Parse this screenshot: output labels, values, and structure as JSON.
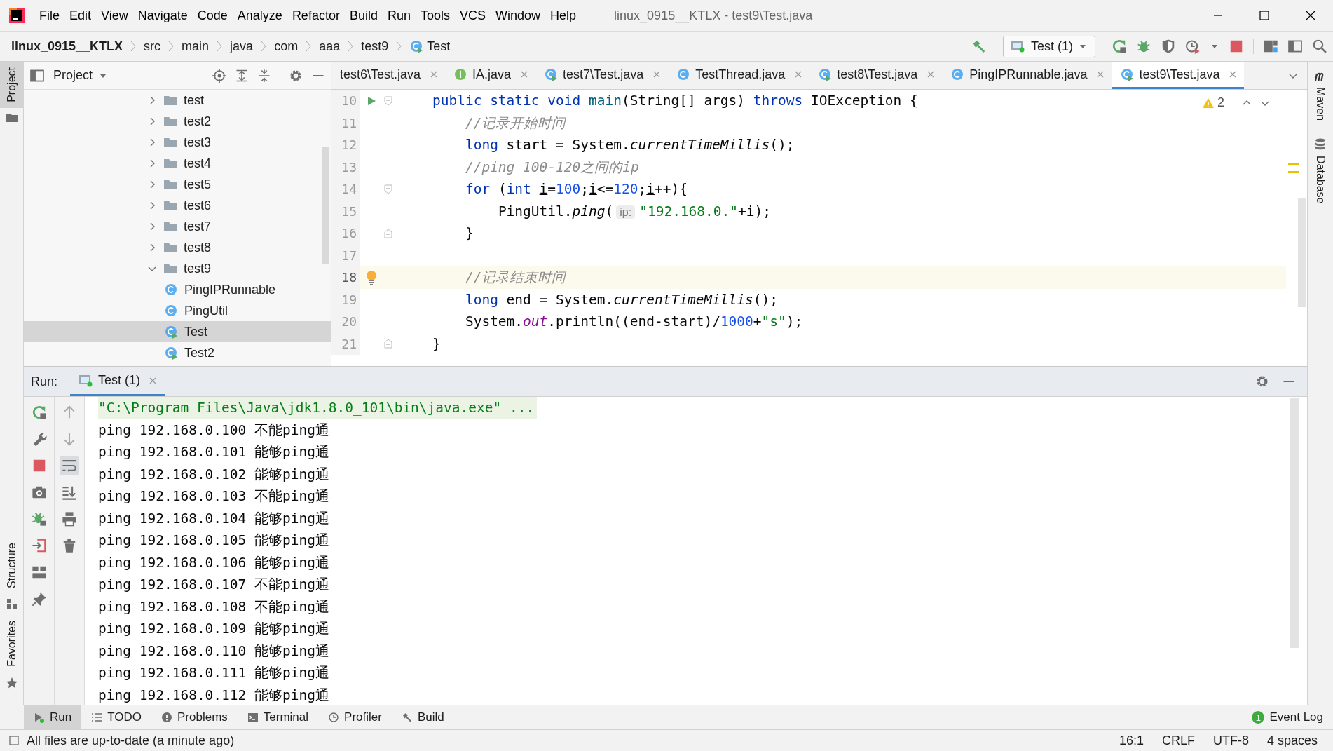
{
  "window": {
    "title": "linux_0915__KTLX - test9\\Test.java"
  },
  "menu": [
    {
      "label": "File"
    },
    {
      "label": "Edit"
    },
    {
      "label": "View"
    },
    {
      "label": "Navigate"
    },
    {
      "label": "Code"
    },
    {
      "label": "Analyze"
    },
    {
      "label": "Refactor"
    },
    {
      "label": "Build"
    },
    {
      "label": "Run"
    },
    {
      "label": "Tools"
    },
    {
      "label": "VCS"
    },
    {
      "label": "Window"
    },
    {
      "label": "Help"
    }
  ],
  "breadcrumbs": [
    {
      "label": "linux_0915__KTLX",
      "kind": "project"
    },
    {
      "label": "src",
      "kind": "folder"
    },
    {
      "label": "main",
      "kind": "folder"
    },
    {
      "label": "java",
      "kind": "folder"
    },
    {
      "label": "com",
      "kind": "folder"
    },
    {
      "label": "aaa",
      "kind": "folder"
    },
    {
      "label": "test9",
      "kind": "folder"
    },
    {
      "label": "Test",
      "kind": "runnable-class"
    }
  ],
  "run_configuration": {
    "label": "Test (1)"
  },
  "left_strip": [
    {
      "label": "Project",
      "selected": true
    },
    {
      "label": "Structure",
      "selected": false
    },
    {
      "label": "Favorites",
      "selected": false
    }
  ],
  "right_strip": [
    {
      "label": "Maven"
    },
    {
      "label": "Database"
    }
  ],
  "project_panel": {
    "title": "Project",
    "tree": [
      {
        "label": "test",
        "kind": "folder",
        "expanded": false,
        "selected": false
      },
      {
        "label": "test2",
        "kind": "folder",
        "expanded": false,
        "selected": false
      },
      {
        "label": "test3",
        "kind": "folder",
        "expanded": false,
        "selected": false
      },
      {
        "label": "test4",
        "kind": "folder",
        "expanded": false,
        "selected": false
      },
      {
        "label": "test5",
        "kind": "folder",
        "expanded": false,
        "selected": false
      },
      {
        "label": "test6",
        "kind": "folder",
        "expanded": false,
        "selected": false
      },
      {
        "label": "test7",
        "kind": "folder",
        "expanded": false,
        "selected": false
      },
      {
        "label": "test8",
        "kind": "folder",
        "expanded": false,
        "selected": false
      },
      {
        "label": "test9",
        "kind": "folder",
        "expanded": true,
        "selected": false,
        "children": [
          {
            "label": "PingIPRunnable",
            "kind": "class",
            "selected": false
          },
          {
            "label": "PingUtil",
            "kind": "class",
            "selected": false
          },
          {
            "label": "Test",
            "kind": "runnable-class",
            "selected": true
          },
          {
            "label": "Test2",
            "kind": "runnable-class",
            "selected": false
          }
        ]
      }
    ]
  },
  "editor_tabs": [
    {
      "label": "test6\\Test.java",
      "kind": "clipped",
      "selected": false
    },
    {
      "label": "IA.java",
      "kind": "interface",
      "selected": false
    },
    {
      "label": "test7\\Test.java",
      "kind": "runnable-class",
      "selected": false
    },
    {
      "label": "TestThread.java",
      "kind": "class",
      "selected": false
    },
    {
      "label": "test8\\Test.java",
      "kind": "runnable-class",
      "selected": false
    },
    {
      "label": "PingIPRunnable.java",
      "kind": "class",
      "selected": false
    },
    {
      "label": "test9\\Test.java",
      "kind": "runnable-class",
      "selected": true
    }
  ],
  "editor": {
    "warning_count": "2",
    "lines": [
      {
        "number": "10",
        "run_marker": true,
        "fold_start": true,
        "fold_end": false,
        "bulb": false,
        "highlighted": false,
        "tokens": [
          {
            "kind": "kw",
            "text": "    public static void "
          },
          {
            "kind": "decl",
            "text": "main"
          },
          {
            "kind": "plain",
            "text": "(String[] args) "
          },
          {
            "kind": "kw",
            "text": "throws "
          },
          {
            "kind": "plain",
            "text": "IOException {"
          }
        ]
      },
      {
        "number": "11",
        "run_marker": false,
        "fold_start": false,
        "fold_end": false,
        "bulb": false,
        "highlighted": false,
        "tokens": [
          {
            "kind": "comment",
            "text": "        //记录开始时间"
          }
        ]
      },
      {
        "number": "12",
        "run_marker": false,
        "fold_start": false,
        "fold_end": false,
        "bulb": false,
        "highlighted": false,
        "tokens": [
          {
            "kind": "kw",
            "text": "        long "
          },
          {
            "kind": "plain",
            "text": "start = System."
          },
          {
            "kind": "static",
            "text": "currentTimeMillis"
          },
          {
            "kind": "plain",
            "text": "();"
          }
        ]
      },
      {
        "number": "13",
        "run_marker": false,
        "fold_start": false,
        "fold_end": false,
        "bulb": false,
        "highlighted": false,
        "tokens": [
          {
            "kind": "comment",
            "text": "        //ping 100-120之间的ip"
          }
        ]
      },
      {
        "number": "14",
        "run_marker": false,
        "fold_start": true,
        "fold_end": false,
        "bulb": false,
        "highlighted": false,
        "tokens": [
          {
            "kind": "kw",
            "text": "        for "
          },
          {
            "kind": "plain",
            "text": "("
          },
          {
            "kind": "kw",
            "text": "int "
          },
          {
            "kind": "var",
            "text": "i"
          },
          {
            "kind": "plain",
            "text": "="
          },
          {
            "kind": "num",
            "text": "100"
          },
          {
            "kind": "plain",
            "text": ";"
          },
          {
            "kind": "var",
            "text": "i"
          },
          {
            "kind": "plain",
            "text": "<="
          },
          {
            "kind": "num",
            "text": "120"
          },
          {
            "kind": "plain",
            "text": ";"
          },
          {
            "kind": "var",
            "text": "i"
          },
          {
            "kind": "plain",
            "text": "++){"
          }
        ]
      },
      {
        "number": "15",
        "run_marker": false,
        "fold_start": false,
        "fold_end": false,
        "bulb": false,
        "highlighted": false,
        "tokens": [
          {
            "kind": "plain",
            "text": "            PingUtil."
          },
          {
            "kind": "static",
            "text": "ping"
          },
          {
            "kind": "plain",
            "text": "("
          },
          {
            "kind": "hint",
            "text": "ip:"
          },
          {
            "kind": "str",
            "text": "\"192.168.0.\""
          },
          {
            "kind": "plain",
            "text": "+"
          },
          {
            "kind": "var",
            "text": "i"
          },
          {
            "kind": "plain",
            "text": ");"
          }
        ]
      },
      {
        "number": "16",
        "run_marker": false,
        "fold_start": false,
        "fold_end": true,
        "bulb": false,
        "highlighted": false,
        "tokens": [
          {
            "kind": "plain",
            "text": "        }"
          }
        ]
      },
      {
        "number": "17",
        "run_marker": false,
        "fold_start": false,
        "fold_end": false,
        "bulb": false,
        "highlighted": false
      },
      {
        "number": "18",
        "run_marker": false,
        "fold_start": false,
        "fold_end": false,
        "bulb": true,
        "highlighted": true,
        "tokens": [
          {
            "kind": "comment",
            "text": "        //记录结束时间"
          }
        ]
      },
      {
        "number": "19",
        "run_marker": false,
        "fold_start": false,
        "fold_end": false,
        "bulb": false,
        "highlighted": false,
        "tokens": [
          {
            "kind": "kw",
            "text": "        long "
          },
          {
            "kind": "plain",
            "text": "end = System."
          },
          {
            "kind": "static",
            "text": "currentTimeMillis"
          },
          {
            "kind": "plain",
            "text": "();"
          }
        ]
      },
      {
        "number": "20",
        "run_marker": false,
        "fold_start": false,
        "fold_end": false,
        "bulb": false,
        "highlighted": false,
        "tokens": [
          {
            "kind": "plain",
            "text": "        System."
          },
          {
            "kind": "field",
            "text": "out"
          },
          {
            "kind": "plain",
            "text": ".println((end-start)/"
          },
          {
            "kind": "num",
            "text": "1000"
          },
          {
            "kind": "plain",
            "text": "+"
          },
          {
            "kind": "str",
            "text": "\"s\""
          },
          {
            "kind": "plain",
            "text": ");"
          }
        ]
      },
      {
        "number": "21",
        "run_marker": false,
        "fold_start": false,
        "fold_end": true,
        "bulb": false,
        "highlighted": false,
        "tokens": [
          {
            "kind": "plain",
            "text": "    }"
          }
        ]
      }
    ]
  },
  "run_panel": {
    "label": "Run:",
    "tab": {
      "label": "Test (1)",
      "selected": true
    },
    "console": [
      {
        "kind": "command",
        "text": "\"C:\\Program Files\\Java\\jdk1.8.0_101\\bin\\java.exe\" ..."
      },
      {
        "kind": "output",
        "text": "ping 192.168.0.100 不能ping通"
      },
      {
        "kind": "output",
        "text": "ping 192.168.0.101 能够ping通"
      },
      {
        "kind": "output",
        "text": "ping 192.168.0.102 能够ping通"
      },
      {
        "kind": "output",
        "text": "ping 192.168.0.103 不能ping通"
      },
      {
        "kind": "output",
        "text": "ping 192.168.0.104 能够ping通"
      },
      {
        "kind": "output",
        "text": "ping 192.168.0.105 能够ping通"
      },
      {
        "kind": "output",
        "text": "ping 192.168.0.106 能够ping通"
      },
      {
        "kind": "output",
        "text": "ping 192.168.0.107 不能ping通"
      },
      {
        "kind": "output",
        "text": "ping 192.168.0.108 不能ping通"
      },
      {
        "kind": "output",
        "text": "ping 192.168.0.109 能够ping通"
      },
      {
        "kind": "output",
        "text": "ping 192.168.0.110 能够ping通"
      },
      {
        "kind": "output",
        "text": "ping 192.168.0.111 能够ping通"
      },
      {
        "kind": "output",
        "text": "ping 192.168.0.112 能够ping通"
      }
    ]
  },
  "tool_tabs": [
    {
      "label": "Run",
      "kind": "run",
      "selected": true
    },
    {
      "label": "TODO",
      "kind": "list",
      "selected": false
    },
    {
      "label": "Problems",
      "kind": "info",
      "selected": false
    },
    {
      "label": "Terminal",
      "kind": "terminal",
      "selected": false
    },
    {
      "label": "Profiler",
      "kind": "profiler",
      "selected": false
    },
    {
      "label": "Build",
      "kind": "hammer",
      "selected": false
    }
  ],
  "event_log": {
    "label": "Event Log",
    "count": "1"
  },
  "status_bar": {
    "message": "All files are up-to-date (a minute ago)",
    "items": [
      "16:1",
      "CRLF",
      "UTF-8",
      "4 spaces"
    ]
  }
}
